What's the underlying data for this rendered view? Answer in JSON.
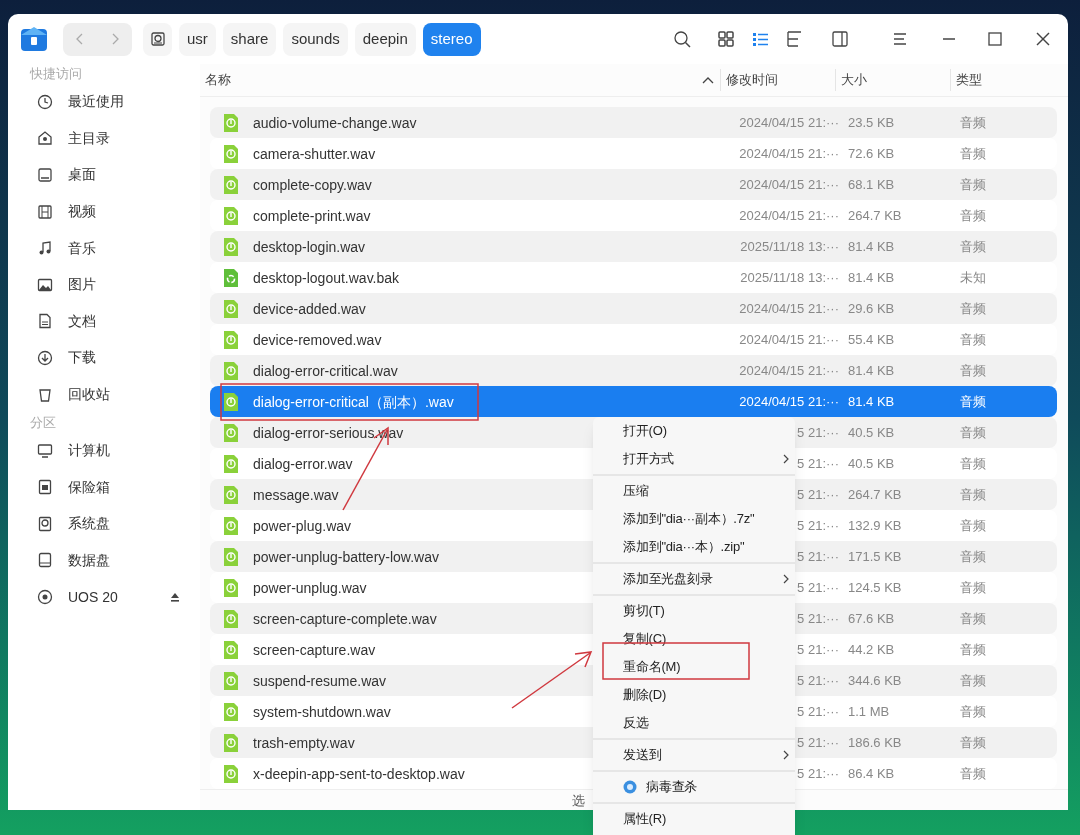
{
  "breadcrumb": [
    {
      "label": "usr",
      "selected": false
    },
    {
      "label": "share",
      "selected": false
    },
    {
      "label": "sounds",
      "selected": false
    },
    {
      "label": "deepin",
      "selected": false
    },
    {
      "label": "stereo",
      "selected": true
    }
  ],
  "view_buttons": [
    {
      "selected": false
    },
    {
      "selected": true
    },
    {
      "selected": false
    }
  ],
  "sidebar": {
    "sections": [
      {
        "title": "快捷访问",
        "items": [
          {
            "label": "最近使用"
          },
          {
            "label": "主目录"
          },
          {
            "label": "桌面"
          },
          {
            "label": "视频"
          },
          {
            "label": "音乐"
          },
          {
            "label": "图片"
          },
          {
            "label": "文档"
          },
          {
            "label": "下载"
          },
          {
            "label": "回收站"
          }
        ]
      },
      {
        "title": "分区",
        "items": [
          {
            "label": "计算机"
          },
          {
            "label": "保险箱"
          },
          {
            "label": "系统盘"
          },
          {
            "label": "数据盘"
          },
          {
            "label": "UOS 20",
            "ejectable": true
          }
        ]
      }
    ]
  },
  "table": {
    "columns": [
      {
        "label": "名称",
        "sorted": true
      },
      {
        "label": "修改时间"
      },
      {
        "label": "大小"
      },
      {
        "label": "类型"
      }
    ],
    "rows": [
      {
        "kind": "audio",
        "name": "audio-volume-change.wav",
        "modified": "2024/04/15 21:···",
        "size": "23.5 KB",
        "type": "音频",
        "selected": false
      },
      {
        "kind": "audio",
        "name": "camera-shutter.wav",
        "modified": "2024/04/15 21:···",
        "size": "72.6 KB",
        "type": "音频",
        "selected": false
      },
      {
        "kind": "audio",
        "name": "complete-copy.wav",
        "modified": "2024/04/15 21:···",
        "size": "68.1 KB",
        "type": "音频",
        "selected": false
      },
      {
        "kind": "audio",
        "name": "complete-print.wav",
        "modified": "2024/04/15 21:···",
        "size": "264.7 KB",
        "type": "音频",
        "selected": false
      },
      {
        "kind": "audio",
        "name": "desktop-login.wav",
        "modified": "2025/11/18 13:···",
        "size": "81.4 KB",
        "type": "音频",
        "selected": false
      },
      {
        "kind": "backup",
        "name": "desktop-logout.wav.bak",
        "modified": "2025/11/18 13:···",
        "size": "81.4 KB",
        "type": "未知",
        "selected": false
      },
      {
        "kind": "audio",
        "name": "device-added.wav",
        "modified": "2024/04/15 21:···",
        "size": "29.6 KB",
        "type": "音频",
        "selected": false
      },
      {
        "kind": "audio",
        "name": "device-removed.wav",
        "modified": "2024/04/15 21:···",
        "size": "55.4 KB",
        "type": "音频",
        "selected": false
      },
      {
        "kind": "audio",
        "name": "dialog-error-critical.wav",
        "modified": "2024/04/15 21:···",
        "size": "81.4 KB",
        "type": "音频",
        "selected": false
      },
      {
        "kind": "audio",
        "name": "dialog-error-critical（副本）.wav",
        "modified": "2024/04/15 21:···",
        "size": "81.4 KB",
        "type": "音频",
        "selected": true
      },
      {
        "kind": "audio",
        "name": "dialog-error-serious.wav",
        "modified": "5 21:···",
        "size": "40.5 KB",
        "type": "音频",
        "selected": false
      },
      {
        "kind": "audio",
        "name": "dialog-error.wav",
        "modified": "5 21:···",
        "size": "40.5 KB",
        "type": "音频",
        "selected": false
      },
      {
        "kind": "audio",
        "name": "message.wav",
        "modified": "5 21:···",
        "size": "264.7 KB",
        "type": "音频",
        "selected": false
      },
      {
        "kind": "audio",
        "name": "power-plug.wav",
        "modified": "5 21:···",
        "size": "132.9 KB",
        "type": "音频",
        "selected": false
      },
      {
        "kind": "audio",
        "name": "power-unplug-battery-low.wav",
        "modified": "5 21:···",
        "size": "171.5 KB",
        "type": "音频",
        "selected": false
      },
      {
        "kind": "audio",
        "name": "power-unplug.wav",
        "modified": "5 21:···",
        "size": "124.5 KB",
        "type": "音频",
        "selected": false
      },
      {
        "kind": "audio",
        "name": "screen-capture-complete.wav",
        "modified": "5 21:···",
        "size": "67.6 KB",
        "type": "音频",
        "selected": false
      },
      {
        "kind": "audio",
        "name": "screen-capture.wav",
        "modified": "5 21:···",
        "size": "44.2 KB",
        "type": "音频",
        "selected": false
      },
      {
        "kind": "audio",
        "name": "suspend-resume.wav",
        "modified": "5 21:···",
        "size": "344.6 KB",
        "type": "音频",
        "selected": false
      },
      {
        "kind": "audio",
        "name": "system-shutdown.wav",
        "modified": "5 21:···",
        "size": "1.1 MB",
        "type": "音频",
        "selected": false
      },
      {
        "kind": "audio",
        "name": "trash-empty.wav",
        "modified": "5 21:···",
        "size": "186.6 KB",
        "type": "音频",
        "selected": false
      },
      {
        "kind": "audio",
        "name": "x-deepin-app-sent-to-desktop.wav",
        "modified": "5 21:···",
        "size": "86.4 KB",
        "type": "音频",
        "selected": false
      }
    ]
  },
  "status_bar": {
    "text": "选"
  },
  "context_menu": [
    {
      "kind": "item",
      "label": "打开(O)"
    },
    {
      "kind": "item",
      "label": "打开方式",
      "submenu": true
    },
    {
      "kind": "separator"
    },
    {
      "kind": "item",
      "label": "压缩"
    },
    {
      "kind": "item",
      "label": "添加到\"dia···副本）.7z\""
    },
    {
      "kind": "item",
      "label": "添加到\"dia···本）.zip\""
    },
    {
      "kind": "separator"
    },
    {
      "kind": "item",
      "label": "添加至光盘刻录",
      "submenu": true
    },
    {
      "kind": "separator"
    },
    {
      "kind": "item",
      "label": "剪切(T)"
    },
    {
      "kind": "item",
      "label": "复制(C)"
    },
    {
      "kind": "item",
      "label": "重命名(M)"
    },
    {
      "kind": "item",
      "label": "删除(D)"
    },
    {
      "kind": "item",
      "label": "反选"
    },
    {
      "kind": "separator"
    },
    {
      "kind": "item",
      "label": "发送到",
      "submenu": true
    },
    {
      "kind": "separator"
    },
    {
      "kind": "icon_item",
      "label": "病毒查杀"
    },
    {
      "kind": "separator"
    },
    {
      "kind": "item",
      "label": "属性(R)"
    }
  ]
}
